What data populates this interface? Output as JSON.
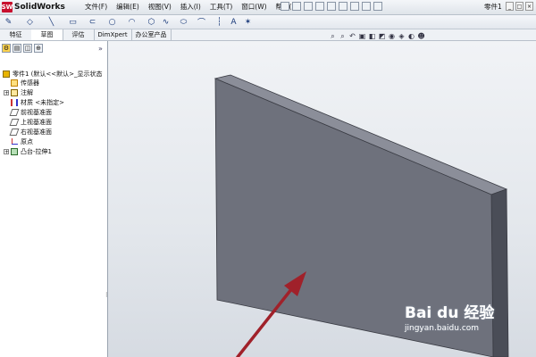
{
  "app": {
    "name": "SolidWorks",
    "logo_mark": "SW"
  },
  "menu": {
    "items": [
      "文件(F)",
      "编辑(E)",
      "视图(V)",
      "插入(I)",
      "工具(T)",
      "窗口(W)",
      "帮助(H)"
    ]
  },
  "document": {
    "title": "零件1"
  },
  "window_controls": {
    "minimize": "_",
    "maximize": "□",
    "close": "×"
  },
  "command_tabs": [
    "特征",
    "草图",
    "评估",
    "DimXpert",
    "办公室产品"
  ],
  "active_tab": "草图",
  "feature_tree": {
    "root": "零件1  (默认<<默认>_显示状态",
    "items": [
      {
        "label": "传感器",
        "icon": "sensor-icon"
      },
      {
        "label": "注解",
        "icon": "annotation-icon"
      },
      {
        "label": "材质 <未指定>",
        "icon": "material-icon"
      },
      {
        "label": "前视基准面",
        "icon": "plane-icon"
      },
      {
        "label": "上视基准面",
        "icon": "plane-icon"
      },
      {
        "label": "右视基准面",
        "icon": "plane-icon"
      },
      {
        "label": "原点",
        "icon": "origin-icon"
      },
      {
        "label": "凸台-拉伸1",
        "icon": "extrude-icon"
      }
    ]
  },
  "watermark": {
    "main": "Bai du 经验",
    "sub": "jingyan.baidu.com"
  },
  "colors": {
    "part_face": "#6e717c",
    "part_top": "#8b8e99",
    "part_side": "#4a4d57",
    "arrow": "#a0212a",
    "logo": "#c8102e"
  }
}
